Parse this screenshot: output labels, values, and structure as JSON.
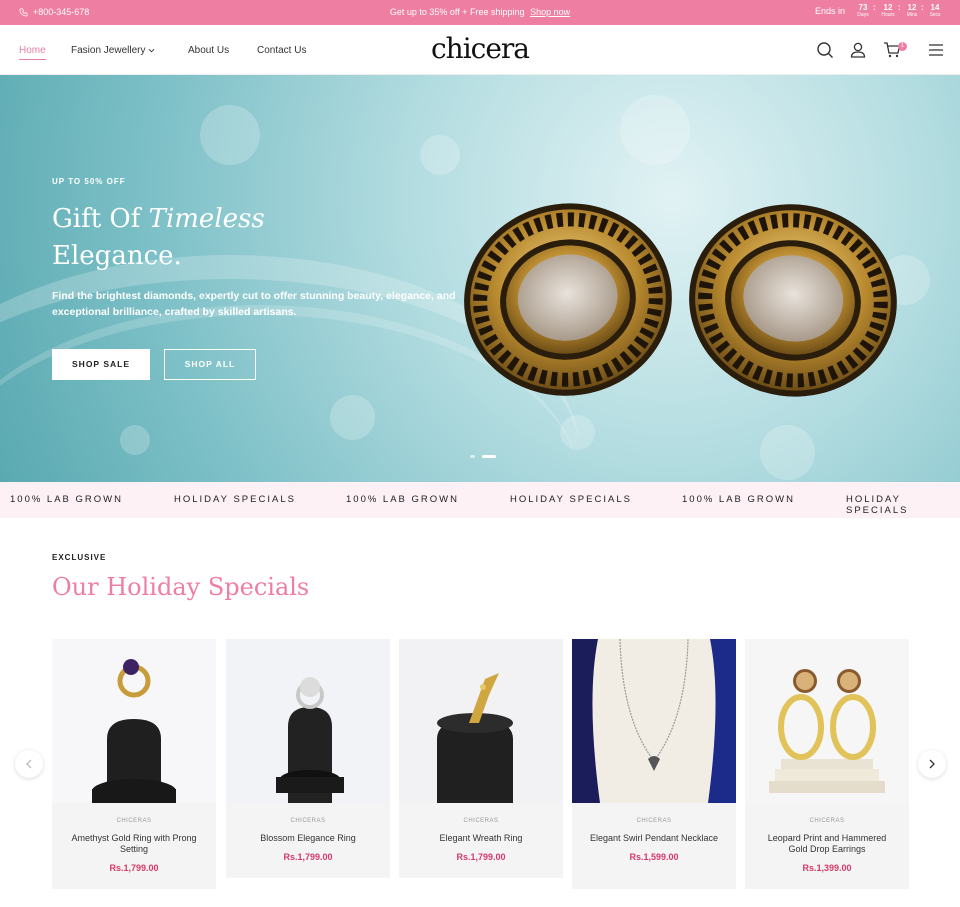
{
  "topbar": {
    "phone": "+800-345-678",
    "promo": "Get up to 35% off + Free shipping",
    "promo_link": "Shop now",
    "ends_label": "Ends in",
    "countdown": [
      {
        "value": "73",
        "unit": "Days"
      },
      {
        "value": "12",
        "unit": "Hours"
      },
      {
        "value": "12",
        "unit": "Mins"
      },
      {
        "value": "14",
        "unit": "Secs"
      }
    ],
    "accent_color": "#ee7ea2"
  },
  "nav": {
    "items": [
      {
        "label": "Home"
      },
      {
        "label": "Fasion Jewellery"
      },
      {
        "label": "About Us"
      },
      {
        "label": "Contact Us"
      }
    ],
    "logo": "chicera",
    "cart_count": "1",
    "icons": [
      "search-icon",
      "user-icon",
      "cart-icon",
      "menu-icon"
    ]
  },
  "hero": {
    "eyebrow": "UP TO 50% OFF",
    "headline_part1": "Gift Of ",
    "headline_italic": "Timeless",
    "headline_part2": "Elegance.",
    "description": "Find the brightest diamonds, expertly cut to offer stunning beauty, elegance, and exceptional brilliance, crafted by skilled artisans.",
    "btn_primary": "SHOP SALE",
    "btn_secondary": "SHOP ALL"
  },
  "marquee": {
    "items": [
      "100% LAB GROWN",
      "HOLIDAY SPECIALS",
      "100% LAB GROWN",
      "HOLIDAY SPECIALS",
      "100% LAB GROWN",
      "HOLIDAY SPECIALS"
    ]
  },
  "section": {
    "eyebrow": "EXCLUSIVE",
    "title": "Our Holiday Specials"
  },
  "products": [
    {
      "brand": "CHICERAS",
      "name": "Amethyst Gold Ring with Prong Setting",
      "price": "Rs.1,799.00"
    },
    {
      "brand": "CHICERAS",
      "name": "Blossom Elegance Ring",
      "price": "Rs.1,799.00"
    },
    {
      "brand": "CHICERAS",
      "name": "Elegant Wreath Ring",
      "price": "Rs.1,799.00"
    },
    {
      "brand": "CHICERAS",
      "name": "Elegant Swirl Pendant Necklace",
      "price": "Rs.1,599.00"
    },
    {
      "brand": "CHICERAS",
      "name": "Leopard Print and Hammered Gold Drop Earrings",
      "price": "Rs.1,399.00"
    }
  ]
}
